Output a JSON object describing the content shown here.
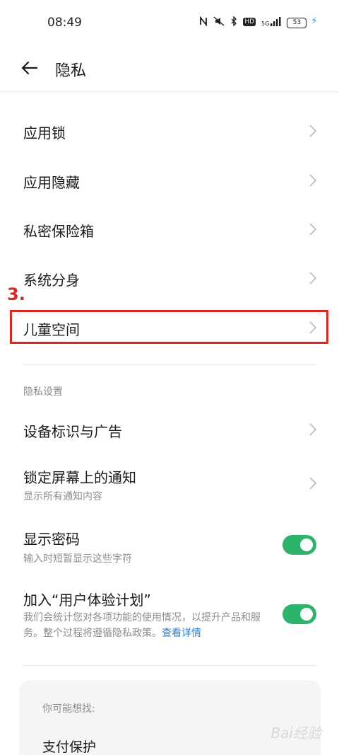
{
  "status": {
    "time": "08:49",
    "icons": [
      "nfc-icon",
      "mute-icon",
      "bluetooth-icon",
      "hd-icon",
      "signal-5g-icon"
    ],
    "hd_label": "HD",
    "net_label": "5G",
    "battery_level": "53"
  },
  "header": {
    "title": "隐私"
  },
  "items": [
    {
      "label": "应用锁"
    },
    {
      "label": "应用隐藏"
    },
    {
      "label": "私密保险箱"
    },
    {
      "label": "系统分身"
    },
    {
      "label": "儿童空间"
    }
  ],
  "annotation": {
    "number": "3."
  },
  "privacy": {
    "section_title": "隐私设置",
    "device_id": {
      "label": "设备标识与广告"
    },
    "lock_notify": {
      "label": "锁定屏幕上的通知",
      "sub": "显示所有通知内容"
    },
    "show_password": {
      "label": "显示密码",
      "sub": "输入时短暂显示这些字符",
      "enabled": true
    },
    "ux_plan": {
      "label": "加入“用户体验计划”",
      "desc": "我们会统计您对各项功能的使用情况，以提升产品和服务。整个过程将遵循隐私政策。",
      "link": "查看详情",
      "enabled": true
    }
  },
  "suggest": {
    "title": "你可能想找:",
    "item": "支付保护"
  },
  "watermark": "Bai经验",
  "colors": {
    "accent": "#2db36b",
    "annotation": "#d42a22",
    "link": "#2680d9"
  }
}
